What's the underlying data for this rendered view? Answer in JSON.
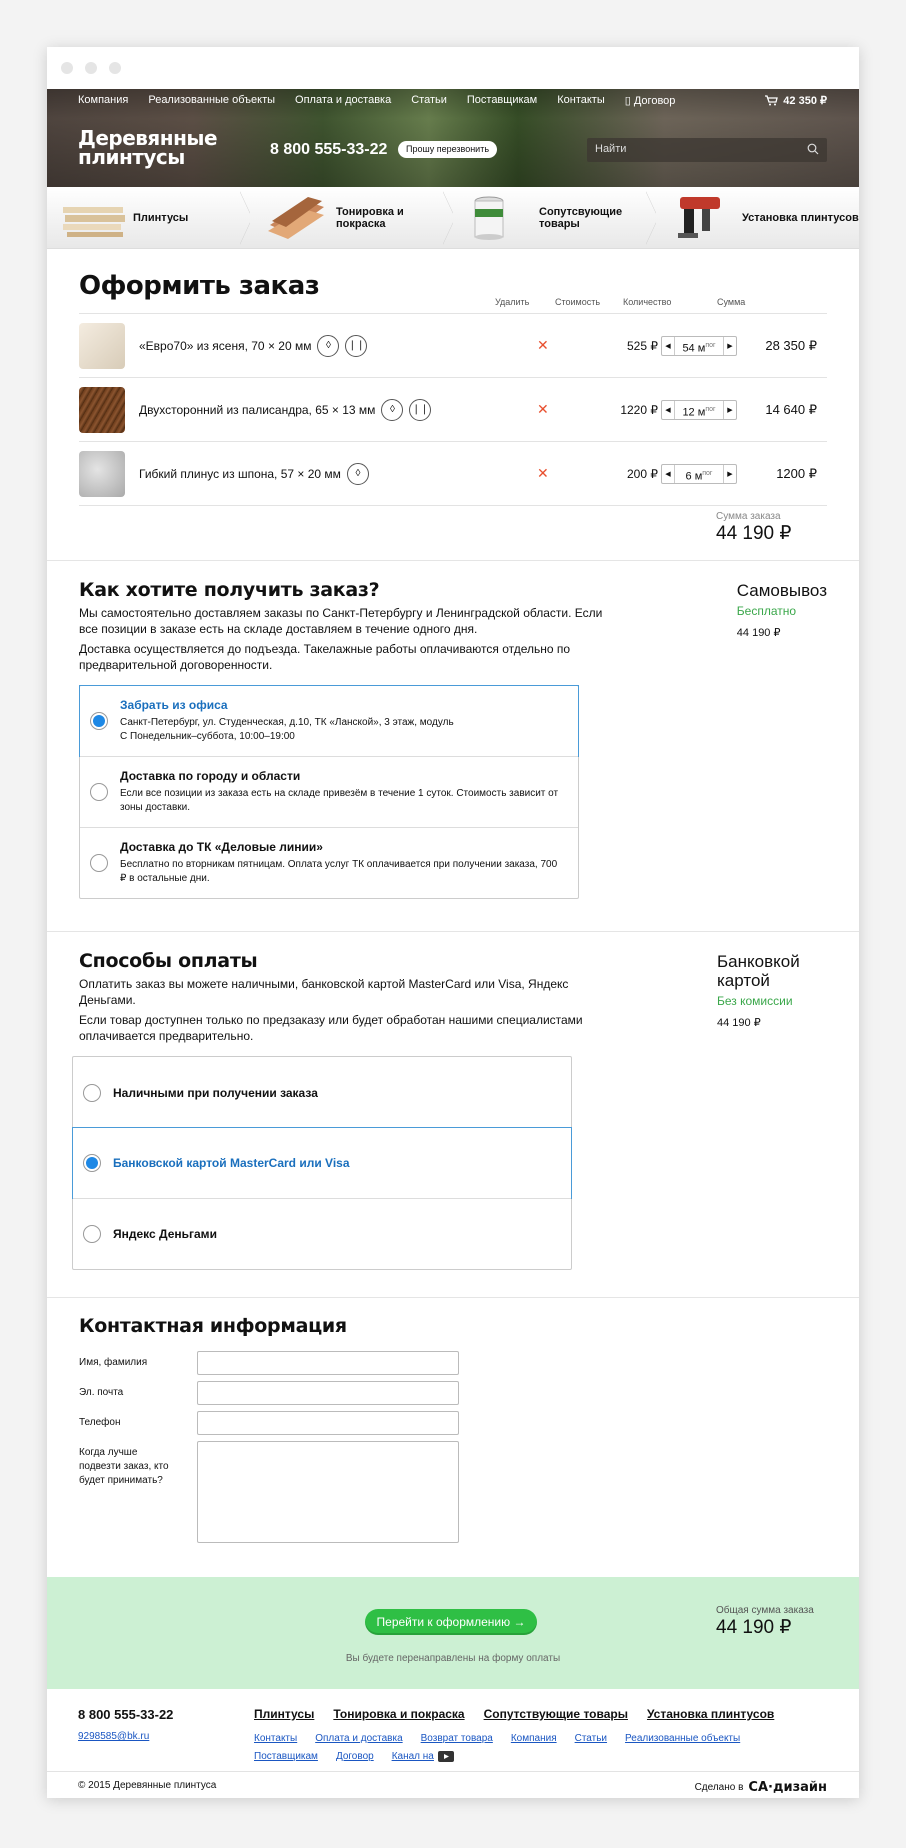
{
  "header": {
    "nav": [
      "Компания",
      "Реализованные объекты",
      "Оплата и доставка",
      "Статьи",
      "Поставщикам",
      "Контакты",
      "Договор"
    ],
    "cart": "42 350 ₽",
    "logo": "Деревянные плинтусы",
    "phone": "8 800 555-33-22",
    "callback": "Прошу перезвонить",
    "search_placeholder": "Найти"
  },
  "categories": [
    {
      "label": "Плинтусы"
    },
    {
      "label": "Тонировка и покраска"
    },
    {
      "label": "Сопутсвующие товары"
    },
    {
      "label": "Установка плинтусов"
    }
  ],
  "order": {
    "title": "Оформить заказ",
    "cols": {
      "delete": "Удалить",
      "price": "Стоимость",
      "qty": "Количество",
      "sum": "Сумма"
    },
    "items": [
      {
        "name": "«Евро70» из ясеня, 70 × 20 мм",
        "price": "525 ₽",
        "qty": "54",
        "unit": "м",
        "unit_sup": "пог",
        "sum": "28 350 ₽",
        "color": "#e8dcc8"
      },
      {
        "name": "Двухсторонний из палисандра, 65 × 13 мм",
        "price": "1220 ₽",
        "qty": "12",
        "unit": "м",
        "unit_sup": "пог",
        "sum": "14 640 ₽",
        "color": "#7a4a24"
      },
      {
        "name": "Гибкий плинус из шпона, 57 × 20 мм",
        "price": "200 ₽",
        "qty": "6",
        "unit": "м",
        "unit_sup": "пог",
        "sum": "1200 ₽",
        "color": "#c9c9c9"
      }
    ],
    "total_label": "Сумма заказа",
    "total": "44 190 ₽"
  },
  "delivery": {
    "title": "Как хотите получить заказ?",
    "text1": "Мы самостоятельно доставляем заказы по Санкт-Петербургу и Ленинградской области. Если все позиции в заказе есть на складе доставляем в течение одного дня.",
    "text2": "Доставка осуществляется до подъезда. Такелажные работы оплачиваются отдельно по предварительной договоренности.",
    "options": [
      {
        "title": "Забрать из офиса",
        "desc": "Санкт-Петербург, ул. Студенческая, д.10, ТК «Ланской», 3 этаж, модуль С Понедельник–суббота, 10:00–19:00"
      },
      {
        "title": "Доставка по городу и области",
        "desc": "Если все позиции из заказа есть на складе привезём в течение 1 суток. Стоимость зависит от зоны доставки."
      },
      {
        "title": "Доставка до ТК «Деловые линии»",
        "desc": "Бесплатно по вторникам пятницам. Оплата услуг ТК оплачивается при получении заказа, 700 ₽ в остальные дни."
      }
    ],
    "side_title": "Самовывоз",
    "side_note": "Бесплатно",
    "side_sum": "44 190 ₽"
  },
  "payment": {
    "title": "Способы оплаты",
    "text1": "Оплатить заказ вы можете наличными, банковской картой MasterCard или Visa, Яндекс Деньгами.",
    "text2": "Если товар доступнен только по предзаказу или будет обработан нашими специалистами оплачивается предварительно.",
    "options": [
      "Наличными при получении заказа",
      "Банковской картой MasterCard или Visa",
      "Яндекс Деньгами"
    ],
    "side_title": "Банковкой картой",
    "side_note": "Без комиссии",
    "side_sum": "44 190 ₽"
  },
  "contact": {
    "title": "Контактная информация",
    "fields": [
      "Имя, фамилия",
      "Эл. почта",
      "Телефон",
      "Когда лучше подвезти заказ, кто будет принимать?"
    ]
  },
  "cta": {
    "button": "Перейти к оформлению →",
    "note": "Вы будете перенаправлены на форму оплаты",
    "total_label": "Общая сумма заказа",
    "total": "44 190 ₽"
  },
  "footer": {
    "phone": "8 800 555-33-22",
    "email": "9298585@bk.ru",
    "main": [
      "Плинтусы",
      "Тонировка и покраска",
      "Сопутствующие товары",
      "Установка плинтусов"
    ],
    "links1": [
      "Контакты",
      "Оплата и доставка",
      "Возврат товара",
      "Компания",
      "Статьи",
      "Реализованные объекты"
    ],
    "links2": [
      "Поставщикам",
      "Договор",
      "Канал на"
    ],
    "copyright": "© 2015 Деревянные плинтуса",
    "made_by": "Сделано в",
    "studio": "СА·дизайн"
  },
  "colors": {
    "accent": "#1e88e5",
    "green": "#2fbf45",
    "cta_bg": "#ccf0d3",
    "delete": "#e8502f"
  }
}
